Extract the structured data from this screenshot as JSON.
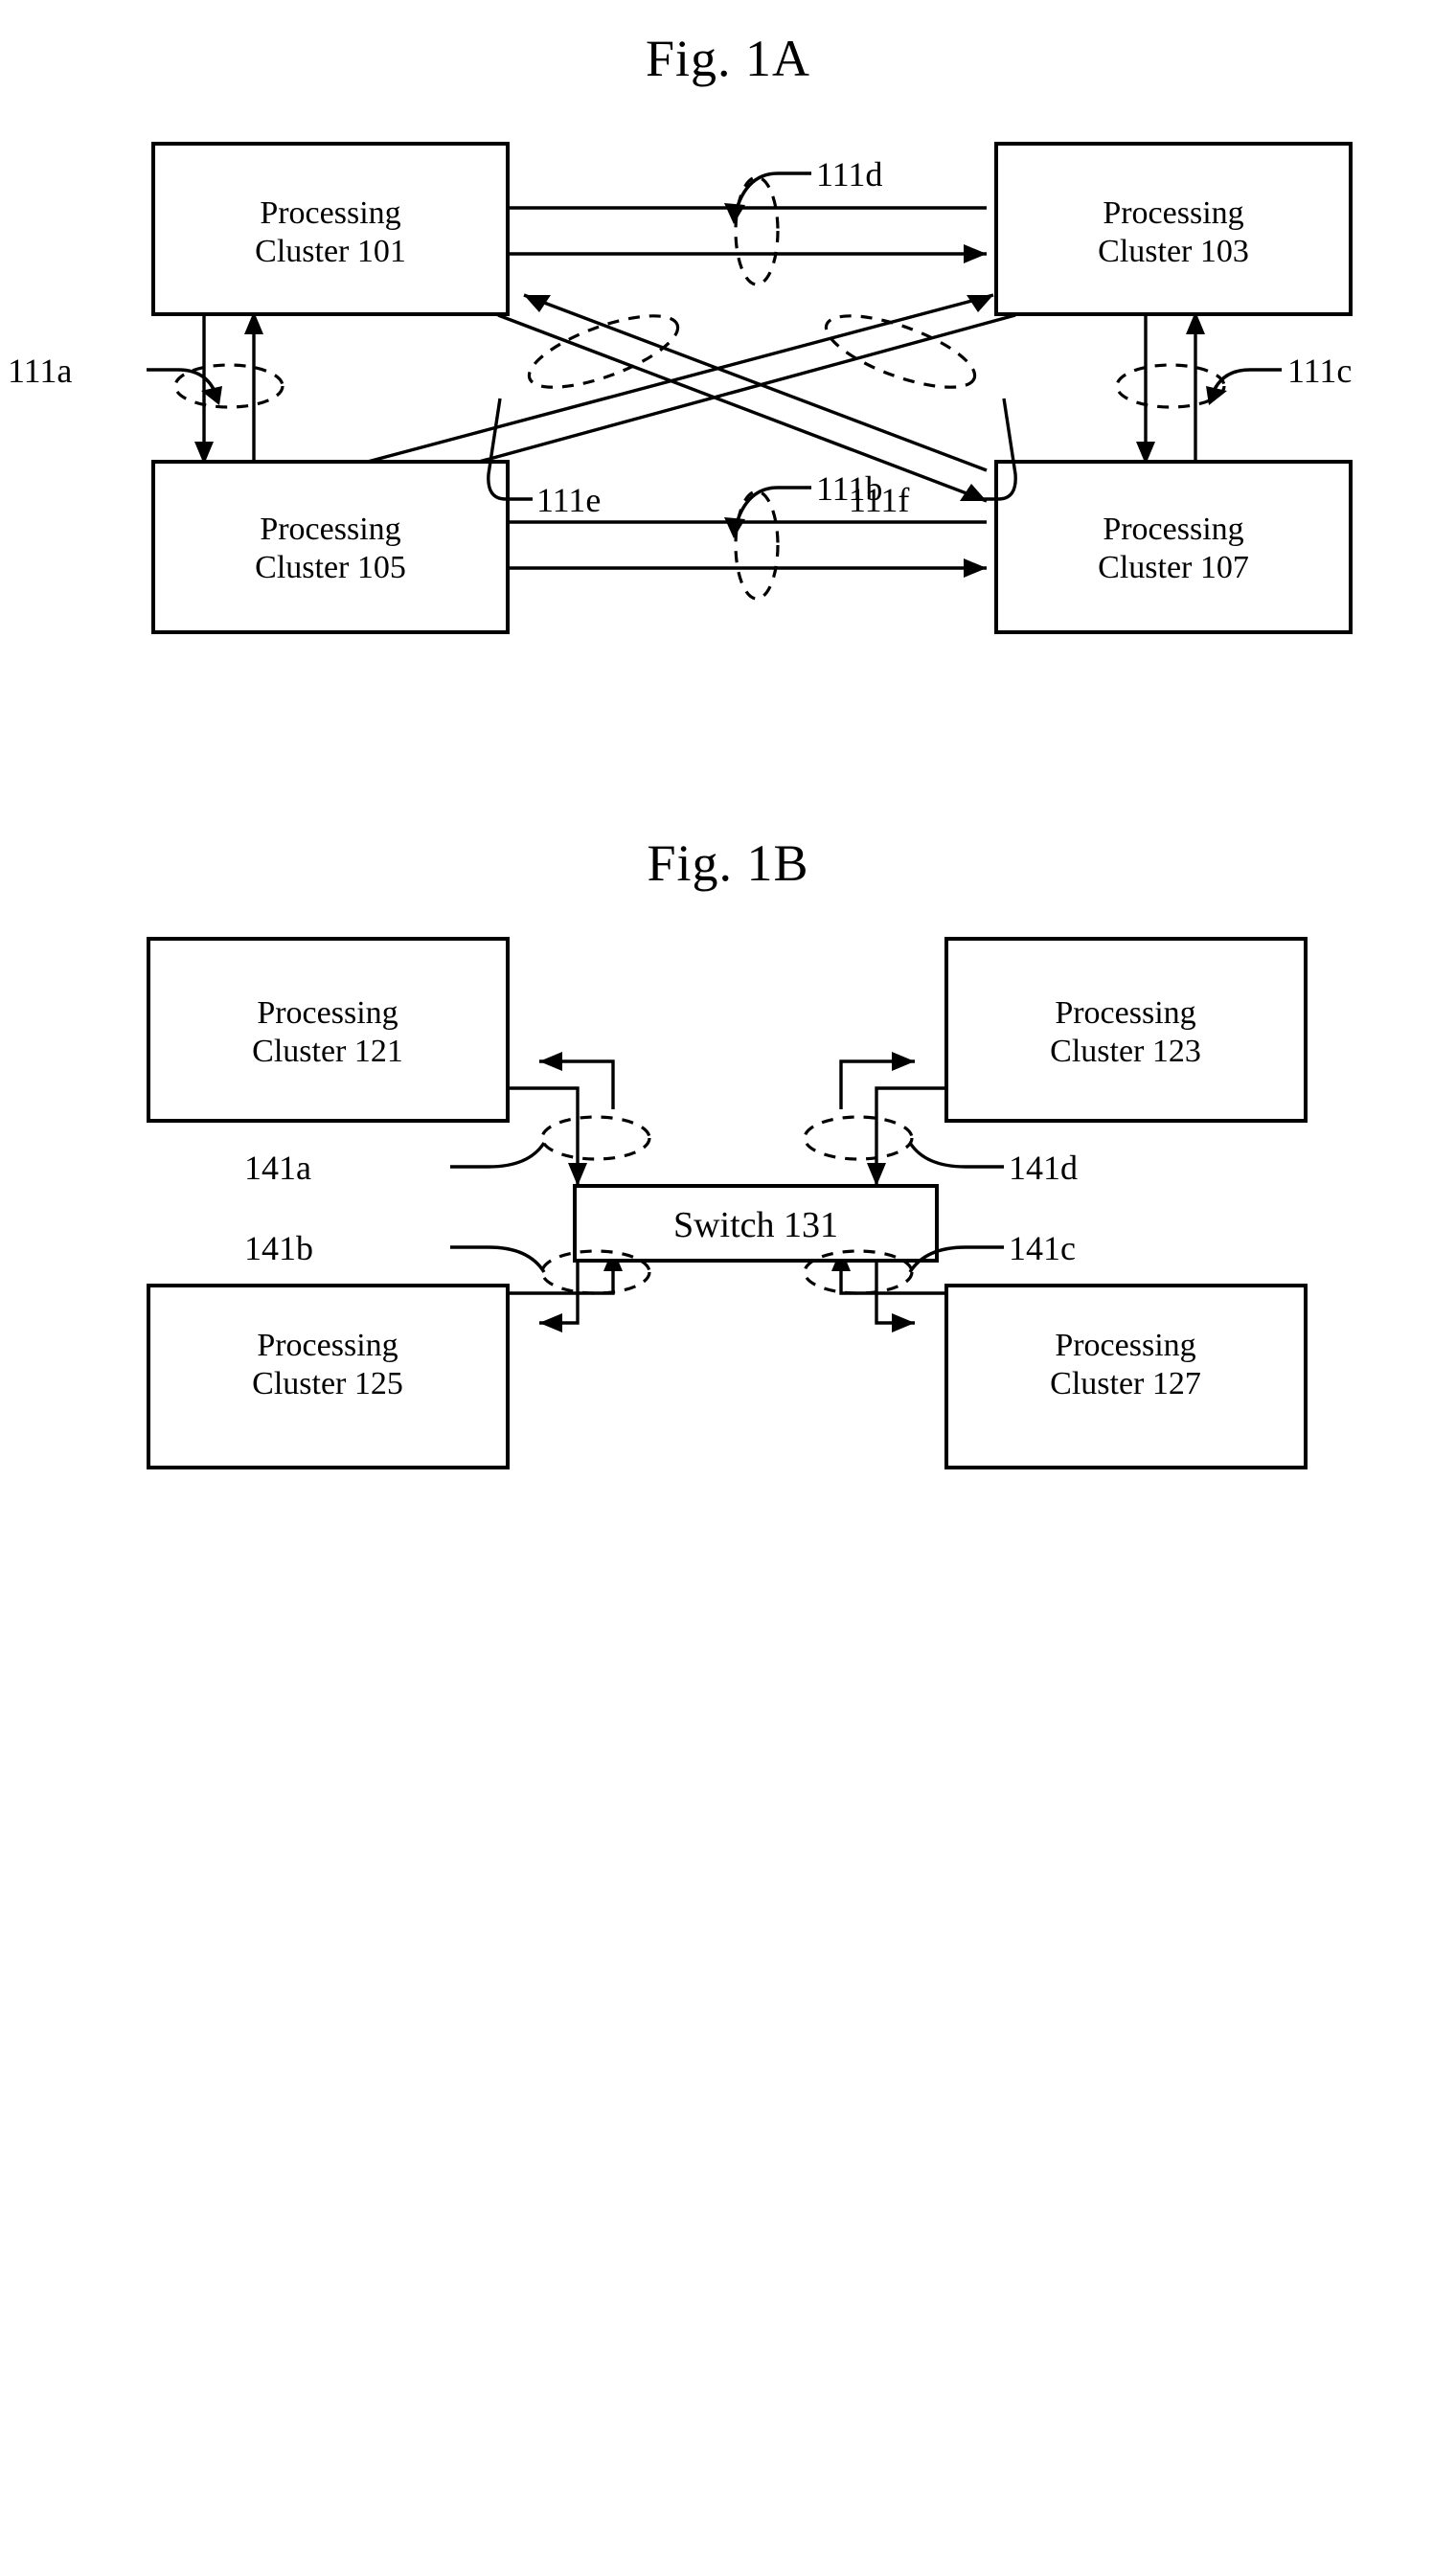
{
  "document": {
    "type": "patent-figure-sheet",
    "figures": [
      {
        "id": "fig1a",
        "title": "Fig. 1A",
        "description": "Four processing clusters fully interconnected by point-to-point links",
        "nodes": [
          {
            "id": "pc101",
            "line1": "Processing",
            "line2": "Cluster 101",
            "position": "top-left"
          },
          {
            "id": "pc103",
            "line1": "Processing",
            "line2": "Cluster 103",
            "position": "top-right"
          },
          {
            "id": "pc105",
            "line1": "Processing",
            "line2": "Cluster 105",
            "position": "bottom-left"
          },
          {
            "id": "pc107",
            "line1": "Processing",
            "line2": "Cluster 107",
            "position": "bottom-right"
          }
        ],
        "links": [
          {
            "id": "111a",
            "label": "111a",
            "between": [
              "pc101",
              "pc105"
            ],
            "orientation": "vertical-left"
          },
          {
            "id": "111b",
            "label": "111b",
            "between": [
              "pc105",
              "pc107"
            ],
            "orientation": "horizontal-bottom"
          },
          {
            "id": "111c",
            "label": "111c",
            "between": [
              "pc103",
              "pc107"
            ],
            "orientation": "vertical-right"
          },
          {
            "id": "111d",
            "label": "111d",
            "between": [
              "pc101",
              "pc103"
            ],
            "orientation": "horizontal-top"
          },
          {
            "id": "111e",
            "label": "111e",
            "between": [
              "pc101",
              "pc107"
            ],
            "orientation": "diagonal"
          },
          {
            "id": "111f",
            "label": "111f",
            "between": [
              "pc103",
              "pc105"
            ],
            "orientation": "diagonal"
          }
        ]
      },
      {
        "id": "fig1b",
        "title": "Fig. 1B",
        "description": "Four processing clusters interconnected through a central switch",
        "nodes": [
          {
            "id": "pc121",
            "line1": "Processing",
            "line2": "Cluster 121",
            "position": "top-left"
          },
          {
            "id": "pc123",
            "line1": "Processing",
            "line2": "Cluster 123",
            "position": "top-right"
          },
          {
            "id": "pc125",
            "line1": "Processing",
            "line2": "Cluster 125",
            "position": "bottom-left"
          },
          {
            "id": "pc127",
            "line1": "Processing",
            "line2": "Cluster 127",
            "position": "bottom-right"
          },
          {
            "id": "switch131",
            "label": "Switch 131",
            "position": "center"
          }
        ],
        "links": [
          {
            "id": "141a",
            "label": "141a",
            "between": [
              "pc121",
              "switch131"
            ]
          },
          {
            "id": "141b",
            "label": "141b",
            "between": [
              "pc125",
              "switch131"
            ]
          },
          {
            "id": "141c",
            "label": "141c",
            "between": [
              "pc127",
              "switch131"
            ]
          },
          {
            "id": "141d",
            "label": "141d",
            "between": [
              "pc123",
              "switch131"
            ]
          }
        ]
      }
    ]
  },
  "colors": {
    "ink": "#000000",
    "paper": "#ffffff"
  }
}
